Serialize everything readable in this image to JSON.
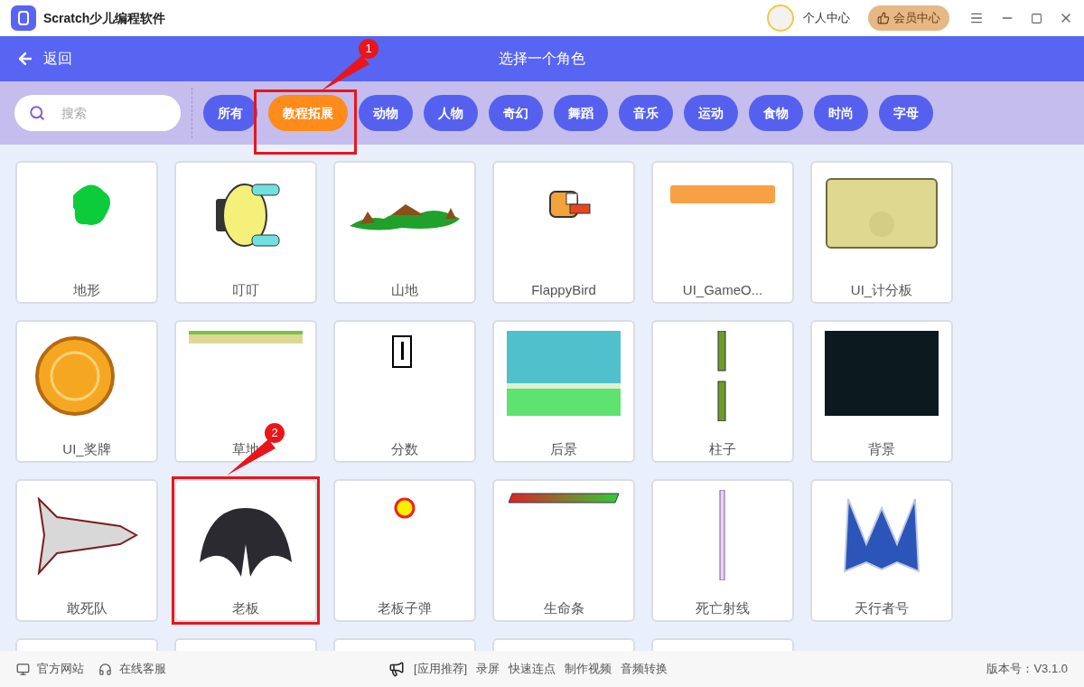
{
  "app": {
    "title": "Scratch少儿编程软件",
    "user_center": "个人中心",
    "vip_button": "会员中心"
  },
  "header": {
    "back": "返回",
    "title": "选择一个角色"
  },
  "search": {
    "placeholder": "搜索"
  },
  "categories": [
    {
      "label": "所有",
      "selected": false
    },
    {
      "label": "教程拓展",
      "selected": true,
      "callout": "1"
    },
    {
      "label": "动物",
      "selected": false
    },
    {
      "label": "人物",
      "selected": false
    },
    {
      "label": "奇幻",
      "selected": false
    },
    {
      "label": "舞蹈",
      "selected": false
    },
    {
      "label": "音乐",
      "selected": false
    },
    {
      "label": "运动",
      "selected": false
    },
    {
      "label": "食物",
      "selected": false
    },
    {
      "label": "时尚",
      "selected": false
    },
    {
      "label": "字母",
      "selected": false
    }
  ],
  "sprites": [
    {
      "name": "地形",
      "kind": "blob"
    },
    {
      "name": "叮叮",
      "kind": "car"
    },
    {
      "name": "山地",
      "kind": "hill"
    },
    {
      "name": "FlappyBird",
      "kind": "bird"
    },
    {
      "name": "UI_GameO...",
      "kind": "banner"
    },
    {
      "name": "UI_计分板",
      "kind": "panel"
    },
    {
      "name": "UI_奖牌",
      "kind": "coin"
    },
    {
      "name": "草地",
      "kind": "strip"
    },
    {
      "name": "分数",
      "kind": "digit"
    },
    {
      "name": "后景",
      "kind": "sky"
    },
    {
      "name": "柱子",
      "kind": "pipes"
    },
    {
      "name": "背景",
      "kind": "dark"
    },
    {
      "name": "敢死队",
      "kind": "jet"
    },
    {
      "name": "老板",
      "kind": "wings",
      "callout": "2"
    },
    {
      "name": "老板子弹",
      "kind": "ring"
    },
    {
      "name": "生命条",
      "kind": "healthbar"
    },
    {
      "name": "死亡射线",
      "kind": "beam"
    },
    {
      "name": "天行者号",
      "kind": "ship"
    },
    {
      "kind": "cut"
    },
    {
      "kind": "cut"
    },
    {
      "kind": "cut"
    },
    {
      "kind": "cut"
    },
    {
      "kind": "cut"
    }
  ],
  "footer": {
    "links": [
      "官方网站",
      "在线客服"
    ],
    "promo_label": "[应用推荐]",
    "promos": [
      "录屏",
      "快速连点",
      "制作视频",
      "音频转换"
    ],
    "version": "版本号：V3.1.0"
  }
}
